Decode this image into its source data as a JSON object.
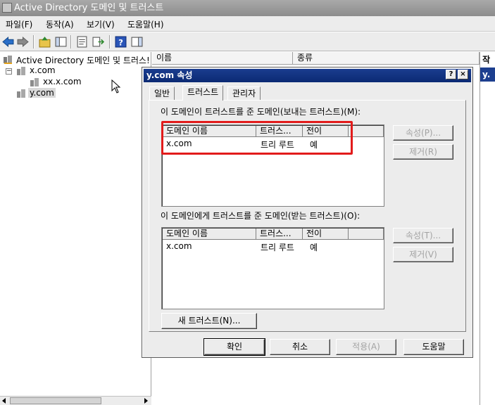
{
  "window": {
    "title": "Active Directory 도메인 및 트러스트"
  },
  "menu": [
    "파일(F)",
    "동작(A)",
    "보기(V)",
    "도움말(H)"
  ],
  "toolbar_icons": [
    "back-arrow-icon",
    "forward-arrow-icon",
    "up-folder-icon",
    "show-hide-tree-icon",
    "properties-icon",
    "export-list-icon",
    "help-icon",
    "action-pane-icon"
  ],
  "tree": {
    "root": "Active Directory 도메인 및 트러스!",
    "items": [
      {
        "label": "x.com"
      },
      {
        "label": "xx.x.com"
      },
      {
        "label": "y.com"
      }
    ]
  },
  "list_columns": [
    "이름",
    "종류"
  ],
  "action_pane": {
    "header": "작",
    "item": "y."
  },
  "dialog": {
    "title": "y.com 속성",
    "help_glyph": "?",
    "close_glyph": "×",
    "tabs": [
      "일반",
      "트러스트",
      "관리자"
    ],
    "active_tab": "트러스트",
    "outgoing": {
      "label": "이 도메인이 트러스트를 준 도메인(보내는 트러스트)(M):",
      "columns": [
        "도메인 이름",
        "트러스...",
        "전이"
      ],
      "rows": [
        {
          "domain": "x.com",
          "trust": "트리 루트",
          "transitive": "예"
        }
      ],
      "properties_button": "속성(P)...",
      "remove_button": "제거(R)"
    },
    "incoming": {
      "label": "이 도메인에게 트러스트를 준 도메인(받는 트러스트)(O):",
      "columns": [
        "도메인 이름",
        "트러스...",
        "전이"
      ],
      "rows": [
        {
          "domain": "x.com",
          "trust": "트리 루트",
          "transitive": "예"
        }
      ],
      "properties_button": "속성(T)...",
      "remove_button": "제거(V)"
    },
    "new_trust_button": "새 트러스트(N)...",
    "footer": {
      "ok": "확인",
      "cancel": "취소",
      "apply": "적용(A)",
      "help": "도움말"
    }
  },
  "colors": {
    "dialog_title": "#0b2a73",
    "highlight": "#e21b1b",
    "window_bg": "#ececec"
  }
}
